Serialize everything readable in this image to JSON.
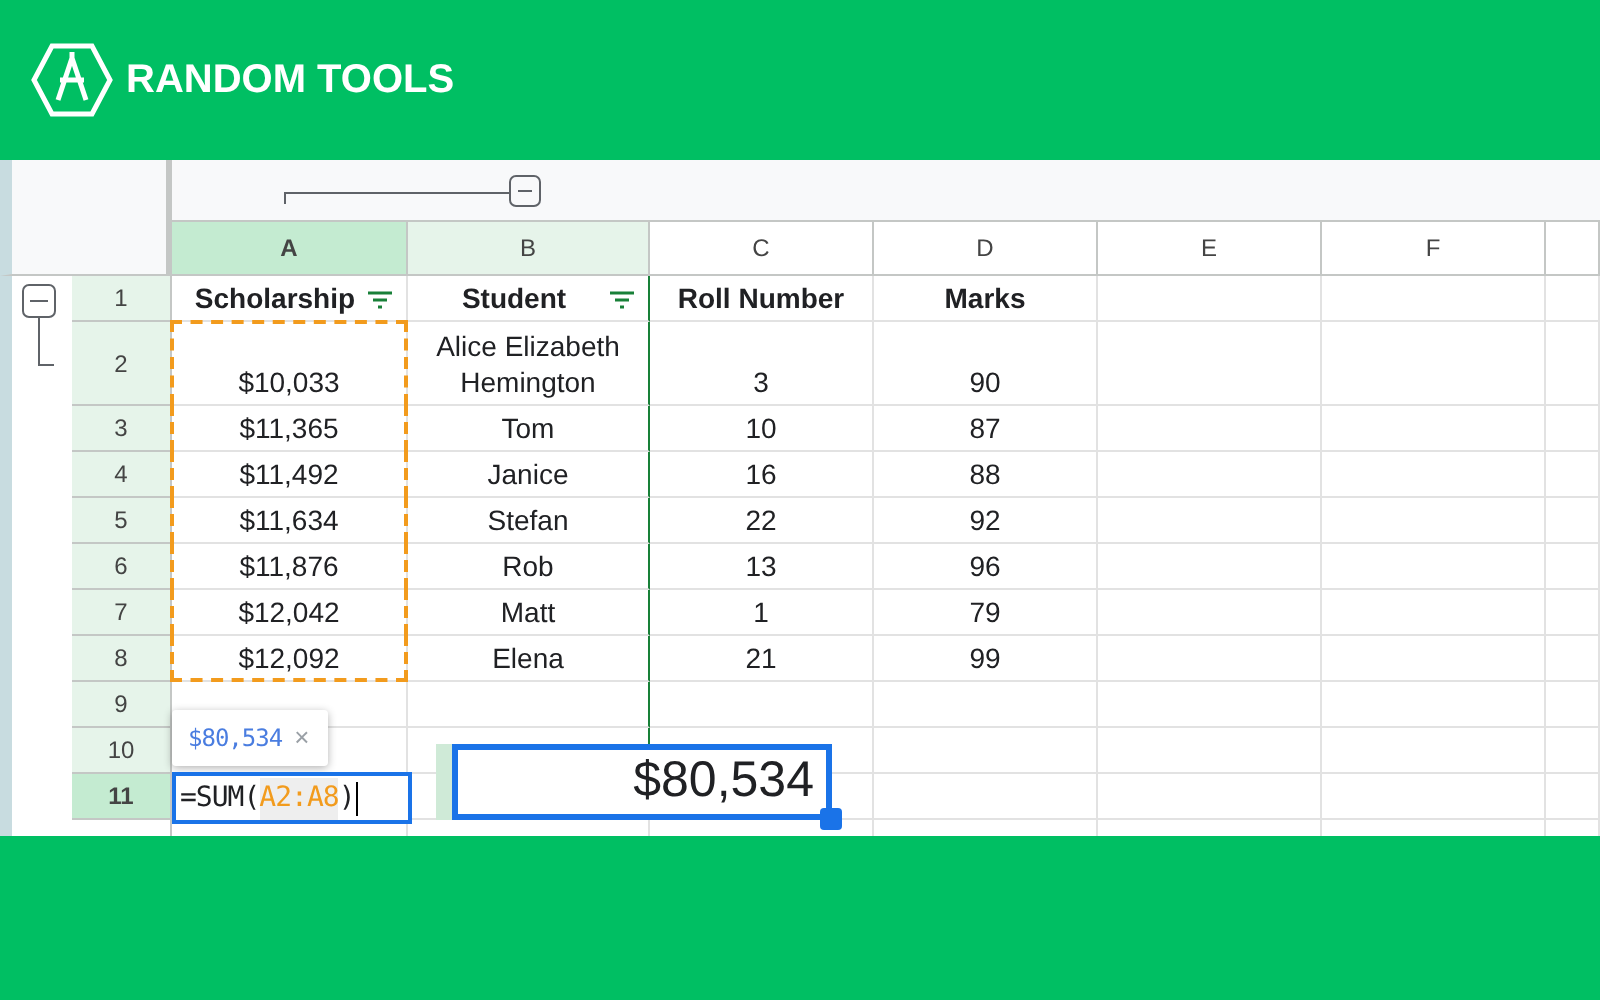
{
  "brand": {
    "name": "RANDOM TOOLS"
  },
  "columns": [
    {
      "label": "A",
      "active": true,
      "highlighted": false
    },
    {
      "label": "B",
      "active": false,
      "highlighted": true
    },
    {
      "label": "C",
      "active": false,
      "highlighted": false
    },
    {
      "label": "D",
      "active": false,
      "highlighted": false
    },
    {
      "label": "E",
      "active": false,
      "highlighted": false
    },
    {
      "label": "F",
      "active": false,
      "highlighted": false
    }
  ],
  "rows": [
    {
      "label": "1",
      "active": false,
      "highlighted": true,
      "kind": "header",
      "marked": false,
      "cells": [
        {
          "text": "Scholarship",
          "filter": true
        },
        {
          "text": "Student",
          "filter": true
        },
        {
          "text": "Roll Number",
          "filter": false
        },
        {
          "text": "Marks",
          "filter": false
        }
      ]
    },
    {
      "label": "2",
      "active": false,
      "highlighted": true,
      "kind": "tall",
      "marked": true,
      "cells": [
        {
          "text": "$10,033"
        },
        {
          "text": "Alice Elizabeth Hemington"
        },
        {
          "text": "3"
        },
        {
          "text": "90"
        }
      ]
    },
    {
      "label": "3",
      "active": false,
      "highlighted": true,
      "kind": "data",
      "marked": true,
      "cells": [
        {
          "text": "$11,365"
        },
        {
          "text": "Tom"
        },
        {
          "text": "10"
        },
        {
          "text": "87"
        }
      ]
    },
    {
      "label": "4",
      "active": false,
      "highlighted": true,
      "kind": "data",
      "marked": true,
      "cells": [
        {
          "text": "$11,492"
        },
        {
          "text": "Janice"
        },
        {
          "text": "16"
        },
        {
          "text": "88"
        }
      ]
    },
    {
      "label": "5",
      "active": false,
      "highlighted": true,
      "kind": "data",
      "marked": true,
      "cells": [
        {
          "text": "$11,634"
        },
        {
          "text": "Stefan"
        },
        {
          "text": "22"
        },
        {
          "text": "92"
        }
      ]
    },
    {
      "label": "6",
      "active": false,
      "highlighted": true,
      "kind": "data",
      "marked": true,
      "cells": [
        {
          "text": "$11,876"
        },
        {
          "text": "Rob"
        },
        {
          "text": "13"
        },
        {
          "text": "96"
        }
      ]
    },
    {
      "label": "7",
      "active": false,
      "highlighted": true,
      "kind": "data",
      "marked": true,
      "cells": [
        {
          "text": "$12,042"
        },
        {
          "text": "Matt"
        },
        {
          "text": "1"
        },
        {
          "text": "79"
        }
      ]
    },
    {
      "label": "8",
      "active": false,
      "highlighted": true,
      "kind": "data",
      "marked": true,
      "cells": [
        {
          "text": "$12,092"
        },
        {
          "text": "Elena"
        },
        {
          "text": "21"
        },
        {
          "text": "99"
        }
      ]
    },
    {
      "label": "9",
      "active": false,
      "highlighted": true,
      "kind": "data",
      "marked": false
    },
    {
      "label": "10",
      "active": false,
      "highlighted": true,
      "kind": "data",
      "marked": false
    },
    {
      "label": "11",
      "active": true,
      "highlighted": false,
      "kind": "data",
      "marked": false
    }
  ],
  "tooltip": {
    "value": "$80,534",
    "close": "×"
  },
  "formula_editor": {
    "parts": [
      {
        "text": "=SUM(",
        "kind": "plain"
      },
      {
        "text": "A2:A8",
        "kind": "ref"
      },
      {
        "text": ")",
        "kind": "plain"
      }
    ]
  },
  "result_box": {
    "value": "$80,534"
  }
}
